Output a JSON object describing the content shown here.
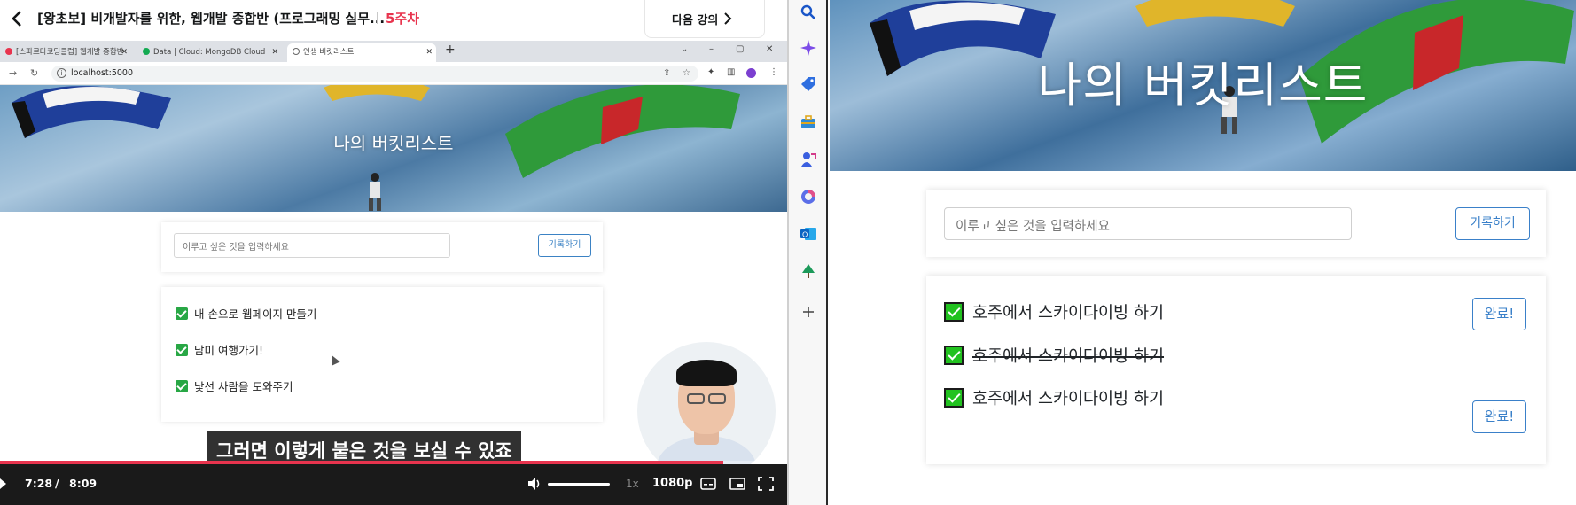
{
  "course": {
    "title": "[왕초보] 비개발자를 위한, 웹개발 종합반 (프로그래밍 실무...",
    "week": "5주차",
    "next_lesson": "다음 강의"
  },
  "browser": {
    "tabs": [
      {
        "label": "[스파르타코딩클럽] 웹개발 종합반",
        "active": false
      },
      {
        "label": "Data | Cloud: MongoDB Cloud",
        "active": false
      },
      {
        "label": "인생 버킷리스트",
        "active": true
      }
    ],
    "url": "localhost:5000"
  },
  "video_page": {
    "title": "나의 버킷리스트",
    "input_placeholder": "이루고 싶은 것을 입력하세요",
    "record_label": "기록하기",
    "items": [
      "내 손으로 웹페이지 만들기",
      "남미 여행가기!",
      "낯선 사람을 도와주기"
    ]
  },
  "player": {
    "subtitle": "그러면 이렇게 붙은 것을 보실 수 있죠",
    "current_time": "7:28",
    "separator": "/",
    "duration": "8:09",
    "progress_percent": 91.9,
    "speed": "1x",
    "quality": "1080p"
  },
  "page": {
    "title": "나의 버킷리스트",
    "input_placeholder": "이루고 싶은 것을 입력하세요",
    "record_label": "기록하기",
    "items": [
      {
        "text": "호주에서 스카이다이빙 하기",
        "done": false,
        "button": "완료!"
      },
      {
        "text": "호주에서 스카이다이빙 하기",
        "done": true
      },
      {
        "text": "호주에서 스카이다이빙 하기",
        "done": false,
        "button": "완료!"
      }
    ]
  },
  "colors": {
    "accent_red": "#e8344e",
    "primary_blue": "#3a80c9",
    "check_green": "#21c21f"
  }
}
